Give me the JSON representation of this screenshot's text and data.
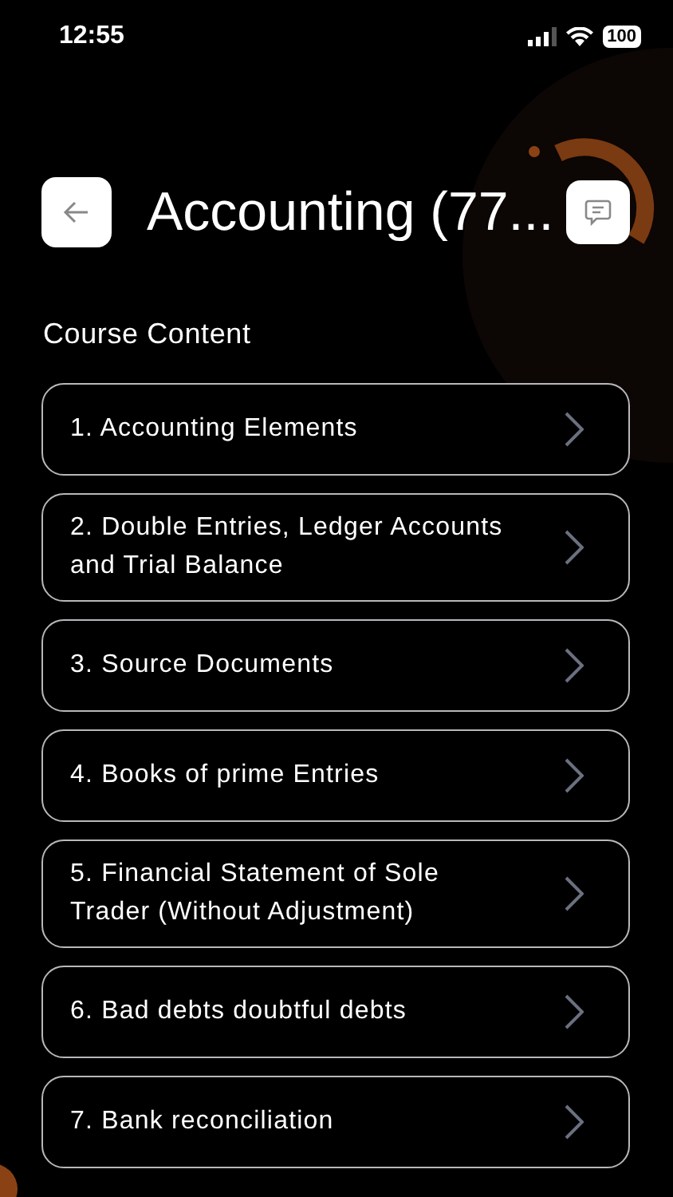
{
  "status_bar": {
    "time": "12:55",
    "battery": "100"
  },
  "header": {
    "title": "Accounting (77..."
  },
  "section_title": "Course Content",
  "lessons": [
    {
      "title": "1. Accounting Elements"
    },
    {
      "title": "2. Double Entries, Ledger Accounts and Trial Balance"
    },
    {
      "title": "3. Source Documents"
    },
    {
      "title": "4. Books of prime Entries"
    },
    {
      "title": "5. Financial Statement of Sole Trader (Without Adjustment)"
    },
    {
      "title": "6. Bad debts doubtful debts"
    },
    {
      "title": "7. Bank reconciliation"
    }
  ]
}
